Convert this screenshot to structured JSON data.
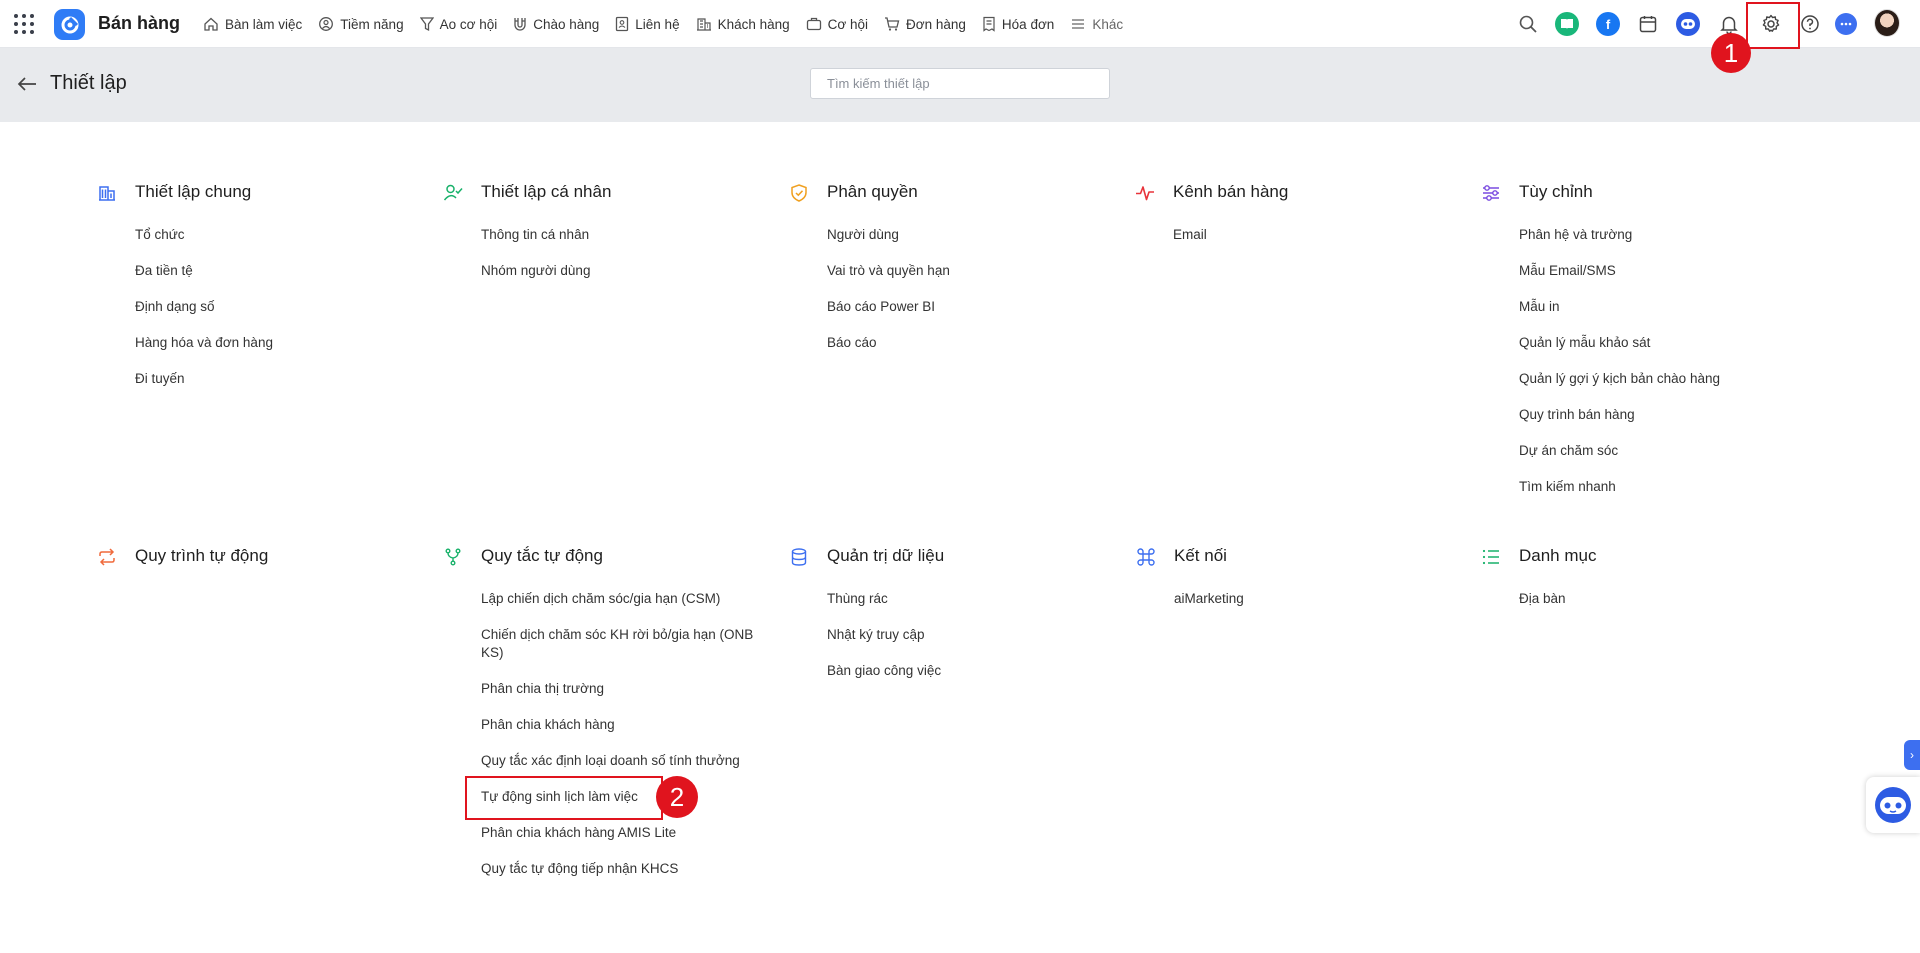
{
  "app": {
    "name": "Bán hàng"
  },
  "nav": {
    "items": [
      {
        "label": "Bàn làm việc",
        "icon": "home-icon"
      },
      {
        "label": "Tiềm năng",
        "icon": "person-circle-icon"
      },
      {
        "label": "Ao cơ hội",
        "icon": "funnel-icon"
      },
      {
        "label": "Chào hàng",
        "icon": "magnet-icon"
      },
      {
        "label": "Liên hệ",
        "icon": "contact-icon"
      },
      {
        "label": "Khách hàng",
        "icon": "building-icon"
      },
      {
        "label": "Cơ hội",
        "icon": "briefcase-icon"
      },
      {
        "label": "Đơn hàng",
        "icon": "cart-icon"
      },
      {
        "label": "Hóa đơn",
        "icon": "invoice-icon"
      },
      {
        "label": "Khác",
        "icon": "hamburger-icon"
      }
    ]
  },
  "page": {
    "title": "Thiết lập",
    "search_placeholder": "Tìm kiếm thiết lập"
  },
  "sections": [
    {
      "title": "Thiết lập chung",
      "icon": "building-icon",
      "color": "#3d6ff0",
      "items": [
        "Tổ chức",
        "Đa tiền tệ",
        "Định dạng số",
        "Hàng hóa và đơn hàng",
        "Đi tuyến"
      ]
    },
    {
      "title": "Thiết lập cá nhân",
      "icon": "user-check-icon",
      "color": "#18b16a",
      "items": [
        "Thông tin cá nhân",
        "Nhóm người dùng"
      ]
    },
    {
      "title": "Phân quyền",
      "icon": "shield-check-icon",
      "color": "#f0a020",
      "items": [
        "Người dùng",
        "Vai trò và quyền hạn",
        "Báo cáo Power BI",
        "Báo cáo"
      ]
    },
    {
      "title": "Kênh bán hàng",
      "icon": "pulse-icon",
      "color": "#e8333a",
      "items": [
        "Email"
      ]
    },
    {
      "title": "Tùy chỉnh",
      "icon": "sliders-icon",
      "color": "#7a4ce0",
      "items": [
        "Phân hệ và trường",
        "Mẫu Email/SMS",
        "Mẫu in",
        "Quản lý mẫu khảo sát",
        "Quản lý gợi ý kịch bản chào hàng",
        "Quy trình bán hàng",
        "Dự án chăm sóc",
        "Tìm kiếm nhanh"
      ]
    },
    {
      "title": "Quy trình tự động",
      "icon": "repeat-icon",
      "color": "#f06a3c",
      "items": []
    },
    {
      "title": "Quy tắc tự động",
      "icon": "branch-icon",
      "color": "#18b16a",
      "items": [
        "Lập chiến dịch chăm sóc/gia hạn (CSM)",
        "Chiến dịch chăm sóc KH rời bỏ/gia hạn (ONB KS)",
        "Phân chia thị trường",
        "Phân chia khách hàng",
        "Quy tắc xác định loại doanh số tính thưởng",
        "Tự động sinh lịch làm việc",
        "Phân chia khách hàng AMIS Lite",
        "Quy tắc tự động tiếp nhận KHCS"
      ]
    },
    {
      "title": "Quản trị dữ liệu",
      "icon": "database-icon",
      "color": "#3d6ff0",
      "items": [
        "Thùng rác",
        "Nhật ký truy cập",
        "Bàn giao công việc"
      ]
    },
    {
      "title": "Kết nối",
      "icon": "command-icon",
      "color": "#3d6ff0",
      "items": [
        "aiMarketing"
      ]
    },
    {
      "title": "Danh mục",
      "icon": "list-icon",
      "color": "#18b16a",
      "items": [
        "Địa bàn"
      ]
    }
  ],
  "annotations": {
    "step1": "1",
    "step2": "2"
  },
  "colors": {
    "accent": "#2f7cf6",
    "highlight": "#e0141e"
  }
}
